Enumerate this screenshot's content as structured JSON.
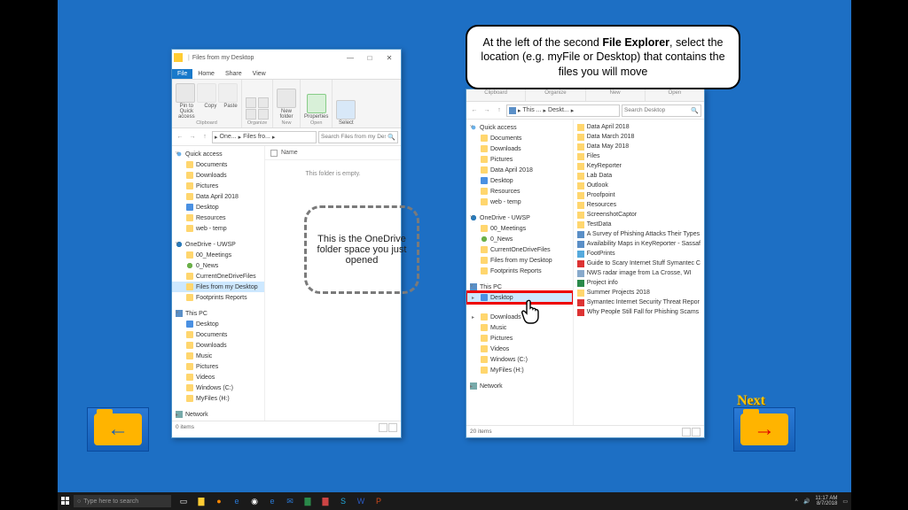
{
  "instruction": {
    "pre": "At the left of the second ",
    "bold": "File Explorer",
    "post": ", select the location (e.g. myFile or Desktop) that contains the files you will move"
  },
  "callout_onedrive": "This is the OneDrive folder space you just opened",
  "next_label": "Next",
  "taskbar": {
    "search_placeholder": "Type here to search",
    "clock_time": "11:17 AM",
    "clock_date": "8/7/2018"
  },
  "explorer1": {
    "title_tab1": "",
    "title_tab2": "Files from my Desktop",
    "tabs": {
      "file": "File",
      "home": "Home",
      "share": "Share",
      "view": "View"
    },
    "ribbon": {
      "pin": "Pin to Quick access",
      "copy": "Copy",
      "paste": "Paste",
      "new_folder": "New folder",
      "properties": "Properties",
      "select": "Select",
      "g_clipboard": "Clipboard",
      "g_organize": "Organize",
      "g_new": "New",
      "g_open": "Open"
    },
    "breadcrumb": [
      "One...",
      "Files fro..."
    ],
    "search_placeholder": "Search Files from my Des...",
    "col_name": "Name",
    "empty": "This folder is empty.",
    "tree": {
      "quick": "Quick access",
      "qitems": [
        "Documents",
        "Downloads",
        "Pictures",
        "Data April 2018",
        "Desktop",
        "Resources",
        "web - temp"
      ],
      "onedrive": "OneDrive - UWSP",
      "od_items": [
        "00_Meetings",
        "0_News",
        "CurrentOneDriveFiles",
        "Files from my Desktop",
        "Footprints Reports"
      ],
      "thispc": "This PC",
      "pc_items": [
        "Desktop",
        "Documents",
        "Downloads",
        "Music",
        "Pictures",
        "Videos",
        "Windows (C:)",
        "MyFiles (H:)"
      ],
      "network": "Network"
    },
    "status": "0 items"
  },
  "explorer2": {
    "ribbon_groups": [
      "Clipboard",
      "Organize",
      "New",
      "Open"
    ],
    "breadcrumb": [
      "This ...",
      "Deskt..."
    ],
    "search_placeholder": "Search Desktop",
    "tree": {
      "quick": "Quick access",
      "qitems": [
        "Documents",
        "Downloads",
        "Pictures",
        "Data April 2018",
        "Desktop",
        "Resources",
        "web - temp"
      ],
      "onedrive": "OneDrive - UWSP",
      "od_items": [
        "00_Meetings",
        "0_News",
        "CurrentOneDriveFiles",
        "Files from my Desktop",
        "Footprints Reports"
      ],
      "thispc": "This PC",
      "pc_desktop": "Desktop",
      "pc_rest": [
        "Downloads",
        "Music",
        "Pictures",
        "Videos",
        "Windows (C:)",
        "MyFiles (H:)"
      ],
      "network": "Network"
    },
    "files": [
      {
        "icon": "fold",
        "name": "Data April 2018"
      },
      {
        "icon": "fold",
        "name": "Data March 2018"
      },
      {
        "icon": "fold",
        "name": "Data May 2018"
      },
      {
        "icon": "fold",
        "name": "Files"
      },
      {
        "icon": "fold",
        "name": "KeyReporter"
      },
      {
        "icon": "fold",
        "name": "Lab Data"
      },
      {
        "icon": "fold",
        "name": "Outlook"
      },
      {
        "icon": "fold",
        "name": "Proofpoint"
      },
      {
        "icon": "fold",
        "name": "Resources"
      },
      {
        "icon": "fold",
        "name": "ScreenshotCaptor"
      },
      {
        "icon": "fold",
        "name": "TestData"
      },
      {
        "icon": "doc",
        "name": "A Survey of Phishing Attacks Their Types"
      },
      {
        "icon": "doc",
        "name": "Availability Maps in KeyReporter - Sassaf"
      },
      {
        "icon": "web",
        "name": "FootPrints"
      },
      {
        "icon": "pdf",
        "name": "Guide to Scary Internet Stuff Symantec C"
      },
      {
        "icon": "img",
        "name": "NWS radar image from La Crosse, WI"
      },
      {
        "icon": "xls",
        "name": "Project info"
      },
      {
        "icon": "fold",
        "name": "Summer Projects 2018"
      },
      {
        "icon": "pdf",
        "name": "Symantec Internet Security Threat Repor"
      },
      {
        "icon": "pdf",
        "name": "Why People Still Fall for Phishing Scams"
      }
    ],
    "status": "20 items"
  }
}
